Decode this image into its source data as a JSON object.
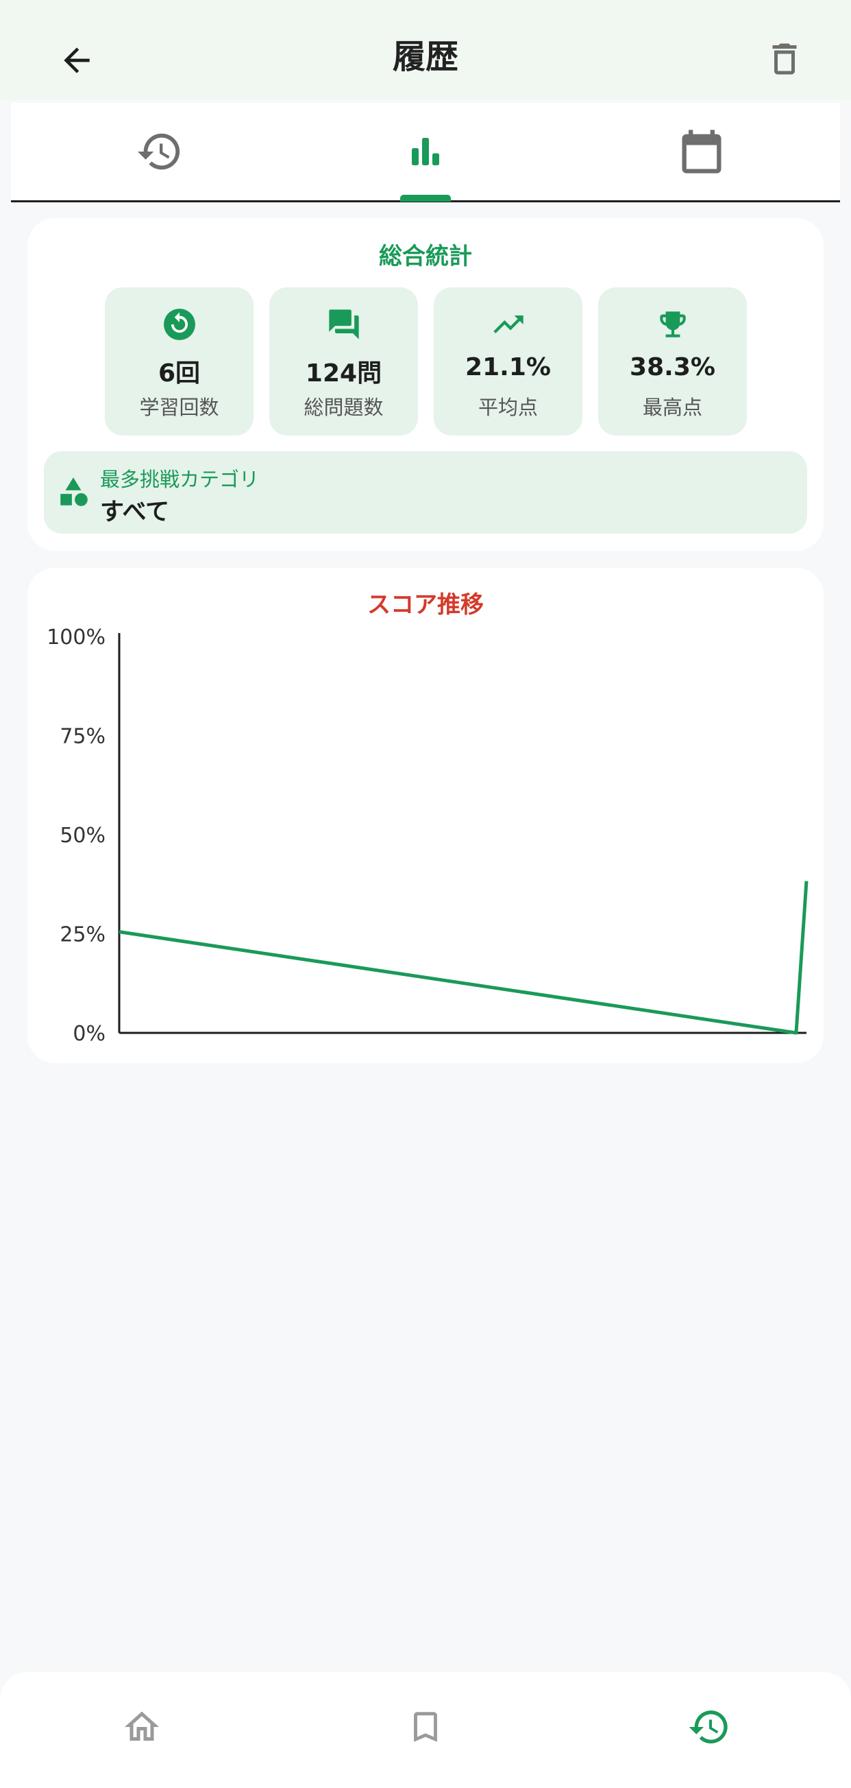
{
  "appbar": {
    "title": "履歴"
  },
  "tabs": [
    {
      "icon": "history-icon",
      "selected": false
    },
    {
      "icon": "bar-chart-icon",
      "selected": true
    },
    {
      "icon": "calendar-icon",
      "selected": false
    }
  ],
  "stats": {
    "title": "総合統計",
    "tiles": [
      {
        "icon": "restart-icon",
        "value": "6回",
        "label": "学習回数"
      },
      {
        "icon": "chat-icon",
        "value": "124問",
        "label": "総問題数"
      },
      {
        "icon": "trending-icon",
        "value": "21.1%",
        "label": "平均点"
      },
      {
        "icon": "trophy-icon",
        "value": "38.3%",
        "label": "最高点"
      }
    ],
    "category": {
      "icon": "category-shapes-icon",
      "label": "最多挑戦カテゴリ",
      "value": "すべて"
    }
  },
  "chart": {
    "title": "スコア推移"
  },
  "chart_data": {
    "type": "line",
    "title": "スコア推移",
    "xlabel": "",
    "ylabel": "",
    "ylim": [
      0,
      100
    ],
    "y_ticks": [
      "0%",
      "25%",
      "50%",
      "75%",
      "100%"
    ],
    "y_tick_values": [
      0,
      25,
      50,
      75,
      100
    ],
    "grid": false,
    "series": [
      {
        "values": [
          25.5,
          0,
          38.3
        ],
        "color": "#1a9a58"
      }
    ],
    "x": [
      0,
      0.985,
      1
    ]
  },
  "bottomnav": [
    {
      "icon": "home-icon",
      "selected": false
    },
    {
      "icon": "bookmark-icon",
      "selected": false
    },
    {
      "icon": "history-icon",
      "selected": true
    }
  ],
  "colors": {
    "accent": "#1a9a58",
    "chart_title": "#d43a2a",
    "tile_bg": "#e5f3ea",
    "appbar_bg": "#f1f7f1",
    "inactive_icon": "#666666"
  }
}
